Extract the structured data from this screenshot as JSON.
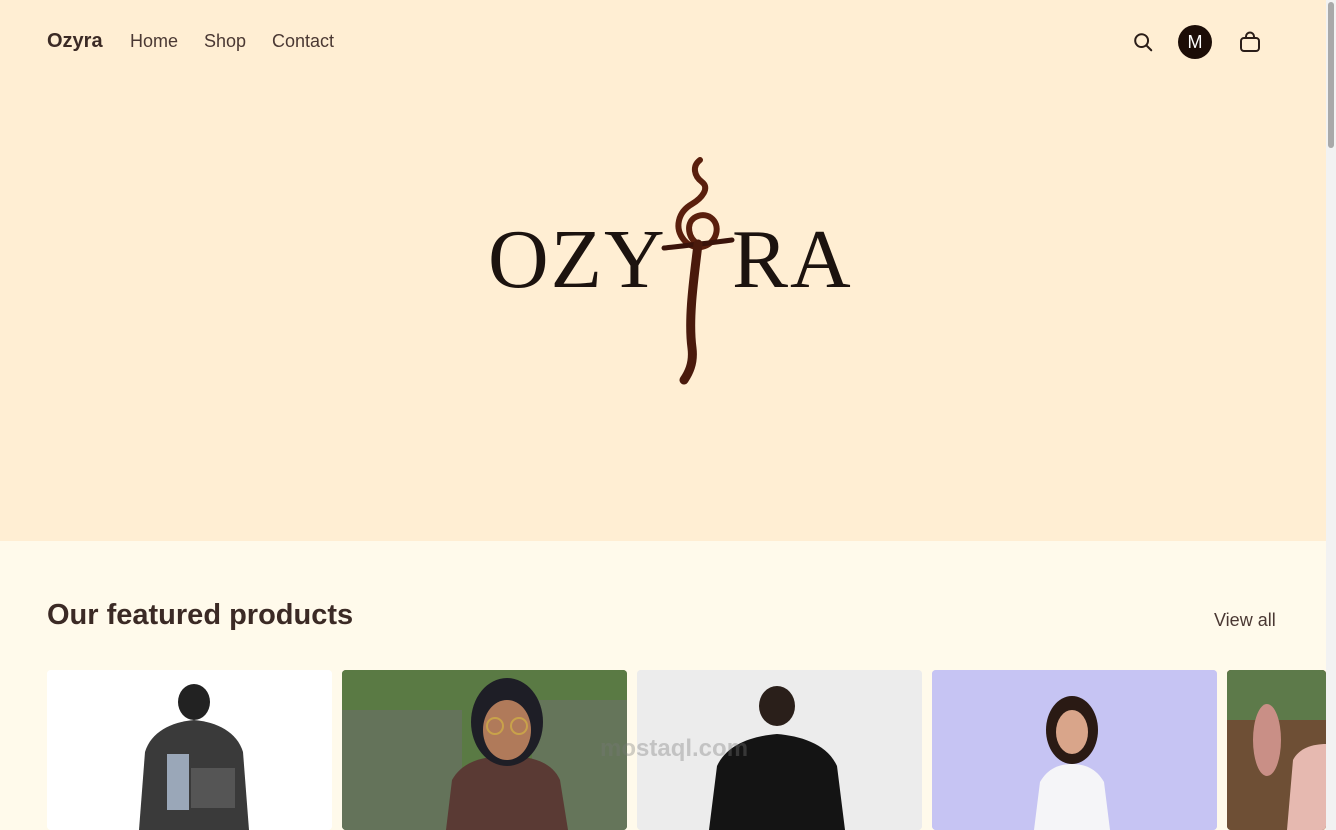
{
  "nav": {
    "brand": "Ozyra",
    "links": [
      "Home",
      "Shop",
      "Contact"
    ],
    "search_icon": "search-icon",
    "avatar_initial": "M",
    "cart_icon": "shopping-bag-icon"
  },
  "hero": {
    "logo_left": "OZY",
    "logo_right": "RA"
  },
  "featured": {
    "title": "Our featured products",
    "view_all": "View all"
  },
  "watermark": "mostaql.com",
  "colors": {
    "hero_bg": "#ffeed3",
    "page_bg": "#fffaeb",
    "text": "#3b2a25",
    "avatar_bg": "#1c0d07",
    "logo_accent": "#5a1f0d"
  }
}
